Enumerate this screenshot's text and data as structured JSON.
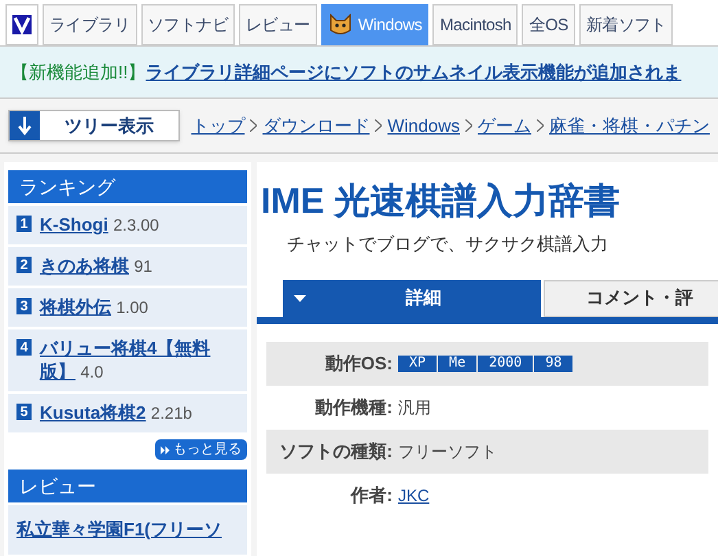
{
  "nav_tabs": [
    {
      "label": "ライブラリ",
      "selected": false
    },
    {
      "label": "ソフトナビ",
      "selected": false
    },
    {
      "label": "レビュー",
      "selected": false
    },
    {
      "label": "Windows",
      "selected": true,
      "icon": true
    },
    {
      "label": "Macintosh",
      "selected": false
    },
    {
      "label": "全OS",
      "selected": false
    },
    {
      "label": "新着ソフト",
      "selected": false
    }
  ],
  "banner": {
    "tag": "【新機能追加!!】",
    "link": "ライブラリ詳細ページにソフトのサムネイル表示機能が追加されま"
  },
  "tree_button": "ツリー表示",
  "breadcrumb": [
    "トップ",
    "ダウンロード",
    "Windows",
    "ゲーム",
    "麻雀・将棋・パチン"
  ],
  "ranking": {
    "title": "ランキング",
    "items": [
      {
        "rank": "1",
        "name": "K-Shogi",
        "version": "2.3.00"
      },
      {
        "rank": "2",
        "name": "きのあ将棋",
        "version": "91"
      },
      {
        "rank": "3",
        "name": "将棋外伝",
        "version": "1.00"
      },
      {
        "rank": "4",
        "name": "バリュー将棋4【無料版】",
        "version": "4.0"
      },
      {
        "rank": "5",
        "name": "Kusuta将棋2",
        "version": "2.21b"
      }
    ],
    "more": "もっと見る"
  },
  "review": {
    "title": "レビュー",
    "item": "私立華々学園F1(フリーソ"
  },
  "software": {
    "title": "IME 光速棋譜入力辞書",
    "subtitle": "チャットでブログで、サクサク棋譜入力"
  },
  "detail_tabs": [
    {
      "label": "詳細",
      "selected": true
    },
    {
      "label": "コメント・評",
      "selected": false
    }
  ],
  "details": [
    {
      "label": "動作OS:",
      "kind": "badges",
      "values": [
        "XP",
        "Me",
        "2000",
        "98"
      ]
    },
    {
      "label": "動作機種:",
      "kind": "text",
      "value": "汎用"
    },
    {
      "label": "ソフトの種類:",
      "kind": "text",
      "value": "フリーソフト"
    },
    {
      "label": "作者:",
      "kind": "link",
      "value": "JKC"
    }
  ]
}
